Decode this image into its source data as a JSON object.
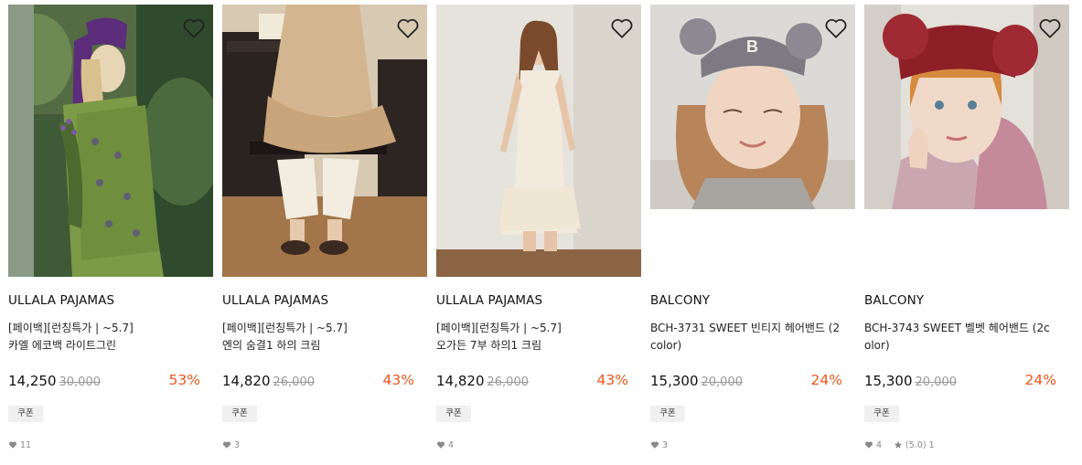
{
  "products": [
    {
      "brand": "ULLALA PAJAMAS",
      "name_line1": "[페이백][런칭특가 | ~5.7]",
      "name_line2": "카엘 에코백 라이트그린",
      "price": "14,250",
      "original_price": "30,000",
      "discount": "53%",
      "coupon": "쿠폰",
      "likes": "11"
    },
    {
      "brand": "ULLALA PAJAMAS",
      "name_line1": "[페이백][런칭특가 | ~5.7]",
      "name_line2": "엔의 숨결1 하의 크림",
      "price": "14,820",
      "original_price": "26,000",
      "discount": "43%",
      "coupon": "쿠폰",
      "likes": "3"
    },
    {
      "brand": "ULLALA PAJAMAS",
      "name_line1": "[페이백][런칭특가 | ~5.7]",
      "name_line2": "오가든 7부 하의1 크림",
      "price": "14,820",
      "original_price": "26,000",
      "discount": "43%",
      "coupon": "쿠폰",
      "likes": "4"
    },
    {
      "brand": "BALCONY",
      "name_line1": "BCH-3731 SWEET 빈티지 헤어밴드 (2",
      "name_line2": "color)",
      "price": "15,300",
      "original_price": "20,000",
      "discount": "24%",
      "coupon": "쿠폰",
      "likes": "3"
    },
    {
      "brand": "BALCONY",
      "name_line1": "BCH-3743 SWEET 벨벳 헤어밴드 (2c",
      "name_line2": "olor)",
      "price": "15,300",
      "original_price": "20,000",
      "discount": "24%",
      "coupon": "쿠폰",
      "likes": "4",
      "rating": "(5.0)",
      "review_count": "1"
    }
  ],
  "colors": {
    "discount": "#f0561d",
    "coupon_bg": "#f0f0f0",
    "muted": "#999999"
  },
  "icons": {
    "wishlist": "heart-outline-icon",
    "likes": "heart-filled-icon",
    "rating": "star-icon"
  }
}
